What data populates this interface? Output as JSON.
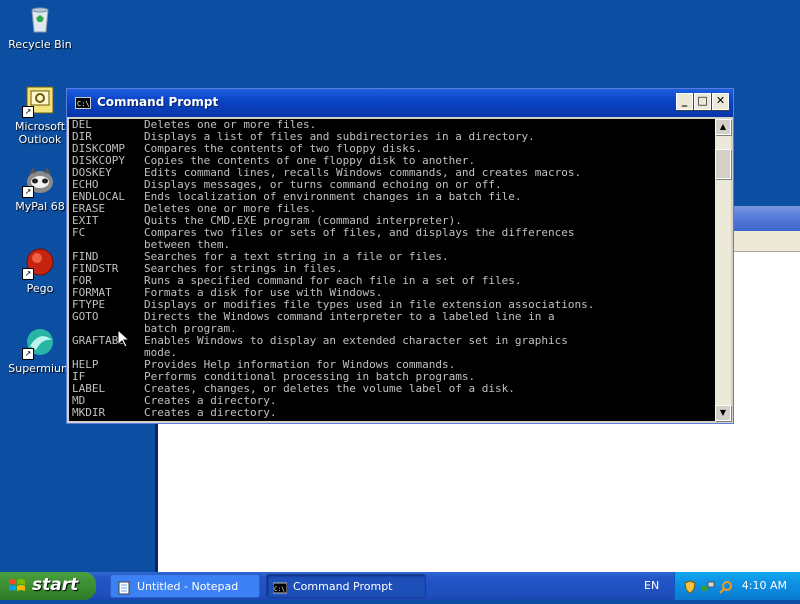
{
  "desktop": {
    "icons": [
      {
        "label": "Recycle Bin"
      },
      {
        "label": "Microsoft Outlook"
      },
      {
        "label": "MyPal 68"
      },
      {
        "label": "Pego"
      },
      {
        "label": "Supermium"
      }
    ]
  },
  "cmd_window": {
    "title": "Command Prompt",
    "controls": {
      "minimize": "_",
      "maximize": "□",
      "close": "✕"
    },
    "lines": [
      {
        "name": "DEL",
        "desc": "Deletes one or more files."
      },
      {
        "name": "DIR",
        "desc": "Displays a list of files and subdirectories in a directory."
      },
      {
        "name": "DISKCOMP",
        "desc": "Compares the contents of two floppy disks."
      },
      {
        "name": "DISKCOPY",
        "desc": "Copies the contents of one floppy disk to another."
      },
      {
        "name": "DOSKEY",
        "desc": "Edits command lines, recalls Windows commands, and creates macros."
      },
      {
        "name": "ECHO",
        "desc": "Displays messages, or turns command echoing on or off."
      },
      {
        "name": "ENDLOCAL",
        "desc": "Ends localization of environment changes in a batch file."
      },
      {
        "name": "ERASE",
        "desc": "Deletes one or more files."
      },
      {
        "name": "EXIT",
        "desc": "Quits the CMD.EXE program (command interpreter)."
      },
      {
        "name": "FC",
        "desc": "Compares two files or sets of files, and displays the differences"
      },
      {
        "name": "",
        "desc": "between them."
      },
      {
        "name": "FIND",
        "desc": "Searches for a text string in a file or files."
      },
      {
        "name": "FINDSTR",
        "desc": "Searches for strings in files."
      },
      {
        "name": "FOR",
        "desc": "Runs a specified command for each file in a set of files."
      },
      {
        "name": "FORMAT",
        "desc": "Formats a disk for use with Windows."
      },
      {
        "name": "FTYPE",
        "desc": "Displays or modifies file types used in file extension associations."
      },
      {
        "name": "GOTO",
        "desc": "Directs the Windows command interpreter to a labeled line in a"
      },
      {
        "name": "",
        "desc": "batch program."
      },
      {
        "name": "GRAFTABL",
        "desc": "Enables Windows to display an extended character set in graphics"
      },
      {
        "name": "",
        "desc": "mode."
      },
      {
        "name": "HELP",
        "desc": "Provides Help information for Windows commands."
      },
      {
        "name": "IF",
        "desc": "Performs conditional processing in batch programs."
      },
      {
        "name": "LABEL",
        "desc": "Creates, changes, or deletes the volume label of a disk."
      },
      {
        "name": "MD",
        "desc": "Creates a directory."
      },
      {
        "name": "MKDIR",
        "desc": "Creates a directory."
      }
    ]
  },
  "taskbar": {
    "start_label": "start",
    "tasks": [
      {
        "label": "Untitled - Notepad"
      },
      {
        "label": "Command Prompt"
      }
    ],
    "language": "EN",
    "clock": "4:10 AM"
  },
  "colors": {
    "desktop": "#0b4ea2",
    "console_bg": "#000000",
    "console_text": "#c0c0c0",
    "title_bar": "#0a44c6",
    "start_button": "#3c8f34",
    "tray": "#0d8de0"
  }
}
